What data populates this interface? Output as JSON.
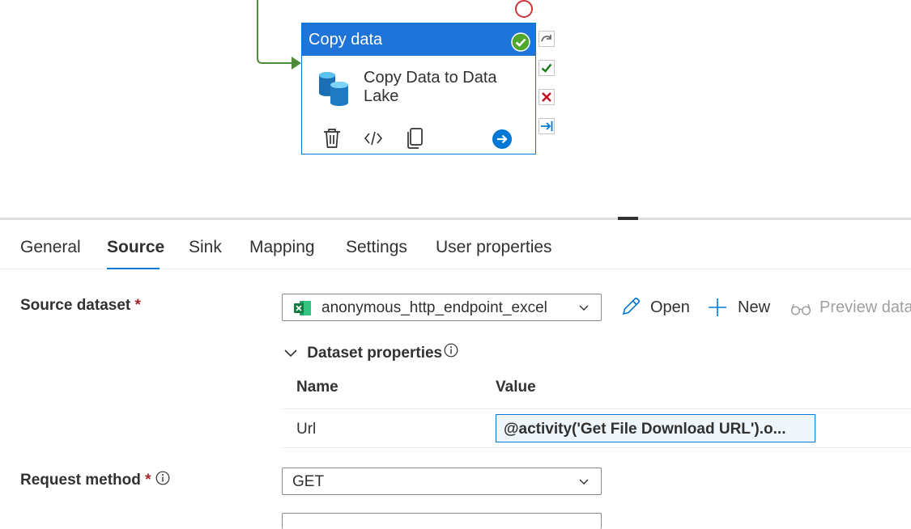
{
  "activity": {
    "type_label": "Copy data",
    "name_line1": "Copy Data to Data",
    "name_line2": "Lake",
    "status": "succeeded",
    "header_color": "#1e74d8",
    "success_color": "#4fa72e"
  },
  "ports": [
    "skip-port",
    "success-port",
    "failure-port",
    "completion-port"
  ],
  "tabs": [
    {
      "label": "General",
      "active": false
    },
    {
      "label": "Source",
      "active": true
    },
    {
      "label": "Sink",
      "active": false
    },
    {
      "label": "Mapping",
      "active": false
    },
    {
      "label": "Settings",
      "active": false
    },
    {
      "label": "User properties",
      "active": false
    }
  ],
  "source": {
    "dataset_label": "Source dataset",
    "required_mark": "*",
    "dataset_value": "anonymous_http_endpoint_excel",
    "dataset_icon": "excel-icon",
    "open_label": "Open",
    "new_label": "New",
    "preview_label": "Preview data",
    "dataset_properties_label": "Dataset properties",
    "grid": {
      "name_header": "Name",
      "value_header": "Value",
      "rows": [
        {
          "name": "Url",
          "value": "@activity('Get File Download URL').o..."
        }
      ]
    },
    "request_method_label": "Request method",
    "request_method_value": "GET"
  },
  "colors": {
    "accent": "#0078d4",
    "required": "#a4262c",
    "success": "#107c10",
    "failure": "#c50f1f"
  }
}
